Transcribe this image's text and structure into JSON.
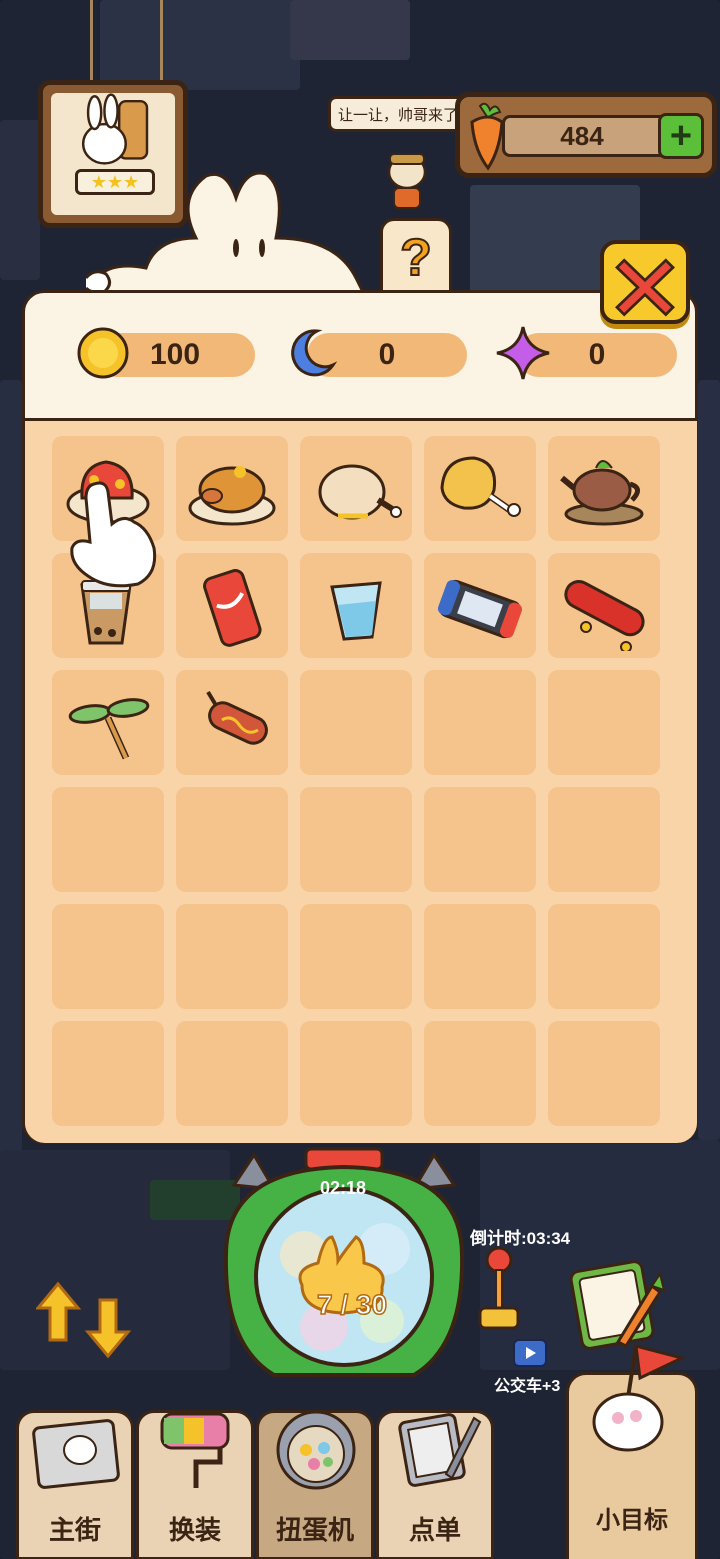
{
  "hud": {
    "speech_text": "让一让，帅哥来了",
    "carrot_count": "484",
    "plus_label": "+",
    "rank_stars": "★★★"
  },
  "panel": {
    "help_label": "?",
    "resources": [
      {
        "name": "sun",
        "value": "100"
      },
      {
        "name": "moon",
        "value": "0"
      },
      {
        "name": "star",
        "value": "0"
      }
    ],
    "slots": [
      {
        "icon": "lobster-dish-icon"
      },
      {
        "icon": "roast-pig-icon"
      },
      {
        "icon": "roast-chicken-icon"
      },
      {
        "icon": "fried-drumstick-icon"
      },
      {
        "icon": "teapot-icon"
      },
      {
        "icon": "bubble-tea-icon"
      },
      {
        "icon": "soda-can-icon"
      },
      {
        "icon": "water-glass-icon"
      },
      {
        "icon": "game-console-icon"
      },
      {
        "icon": "skateboard-icon"
      },
      {
        "icon": "bamboo-dragonfly-icon"
      },
      {
        "icon": "sausage-skewer-icon"
      },
      {
        "icon": ""
      },
      {
        "icon": ""
      },
      {
        "icon": ""
      },
      {
        "icon": ""
      },
      {
        "icon": ""
      },
      {
        "icon": ""
      },
      {
        "icon": ""
      },
      {
        "icon": ""
      },
      {
        "icon": ""
      },
      {
        "icon": ""
      },
      {
        "icon": ""
      },
      {
        "icon": ""
      },
      {
        "icon": ""
      },
      {
        "icon": ""
      },
      {
        "icon": ""
      },
      {
        "icon": ""
      },
      {
        "icon": ""
      },
      {
        "icon": ""
      }
    ]
  },
  "machine": {
    "timer": "02:18",
    "progress_text": "7 / 30",
    "progress": {
      "current": 7,
      "total": 30
    }
  },
  "side": {
    "countdown": "倒计时:03:34",
    "bus_label": "公交车+3"
  },
  "nav": {
    "items": [
      {
        "label": "主街"
      },
      {
        "label": "换装"
      },
      {
        "label": "扭蛋机"
      },
      {
        "label": "点单"
      },
      {
        "label": "小目标"
      }
    ]
  },
  "colors": {
    "panel_bg": "#fbf3e4",
    "grid_bg": "#f8d4a8",
    "slot_bg": "#f5c48d",
    "outline": "#3b2414",
    "accent_yellow": "#f7c92a",
    "accent_green": "#5cbf3a"
  }
}
